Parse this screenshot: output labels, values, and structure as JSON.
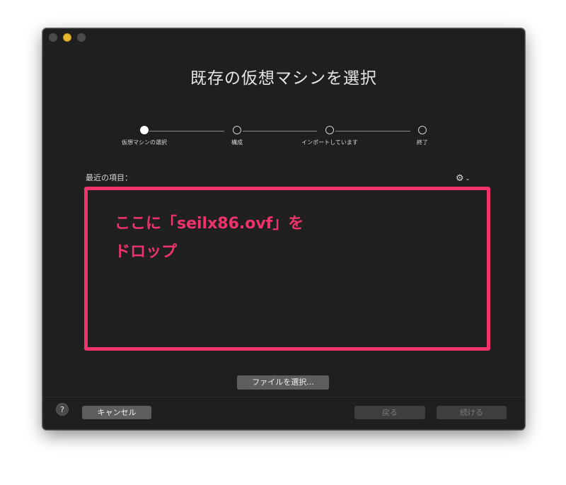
{
  "window": {
    "title": "既存の仮想マシンを選択"
  },
  "steps": [
    {
      "label": "仮想マシンの選択",
      "active": true
    },
    {
      "label": "構成",
      "active": false
    },
    {
      "label": "インポートしています",
      "active": false
    },
    {
      "label": "終了",
      "active": false
    }
  ],
  "recent": {
    "label": "最近の項目："
  },
  "icons": {
    "gear": "gear-icon",
    "chevron": "chevron-down-icon",
    "help": "help-icon"
  },
  "annotation": {
    "text": "ここに「seilx86.ovf」を\nドロップ",
    "color": "#f0336a"
  },
  "buttons": {
    "choose_file": "ファイルを選択...",
    "help": "?",
    "cancel": "キャンセル",
    "back": "戻る",
    "continue": "続ける"
  },
  "colors": {
    "annotation": "#f0336a",
    "window_bg": "#1f1f1f",
    "minimize": "#e6b82e"
  }
}
